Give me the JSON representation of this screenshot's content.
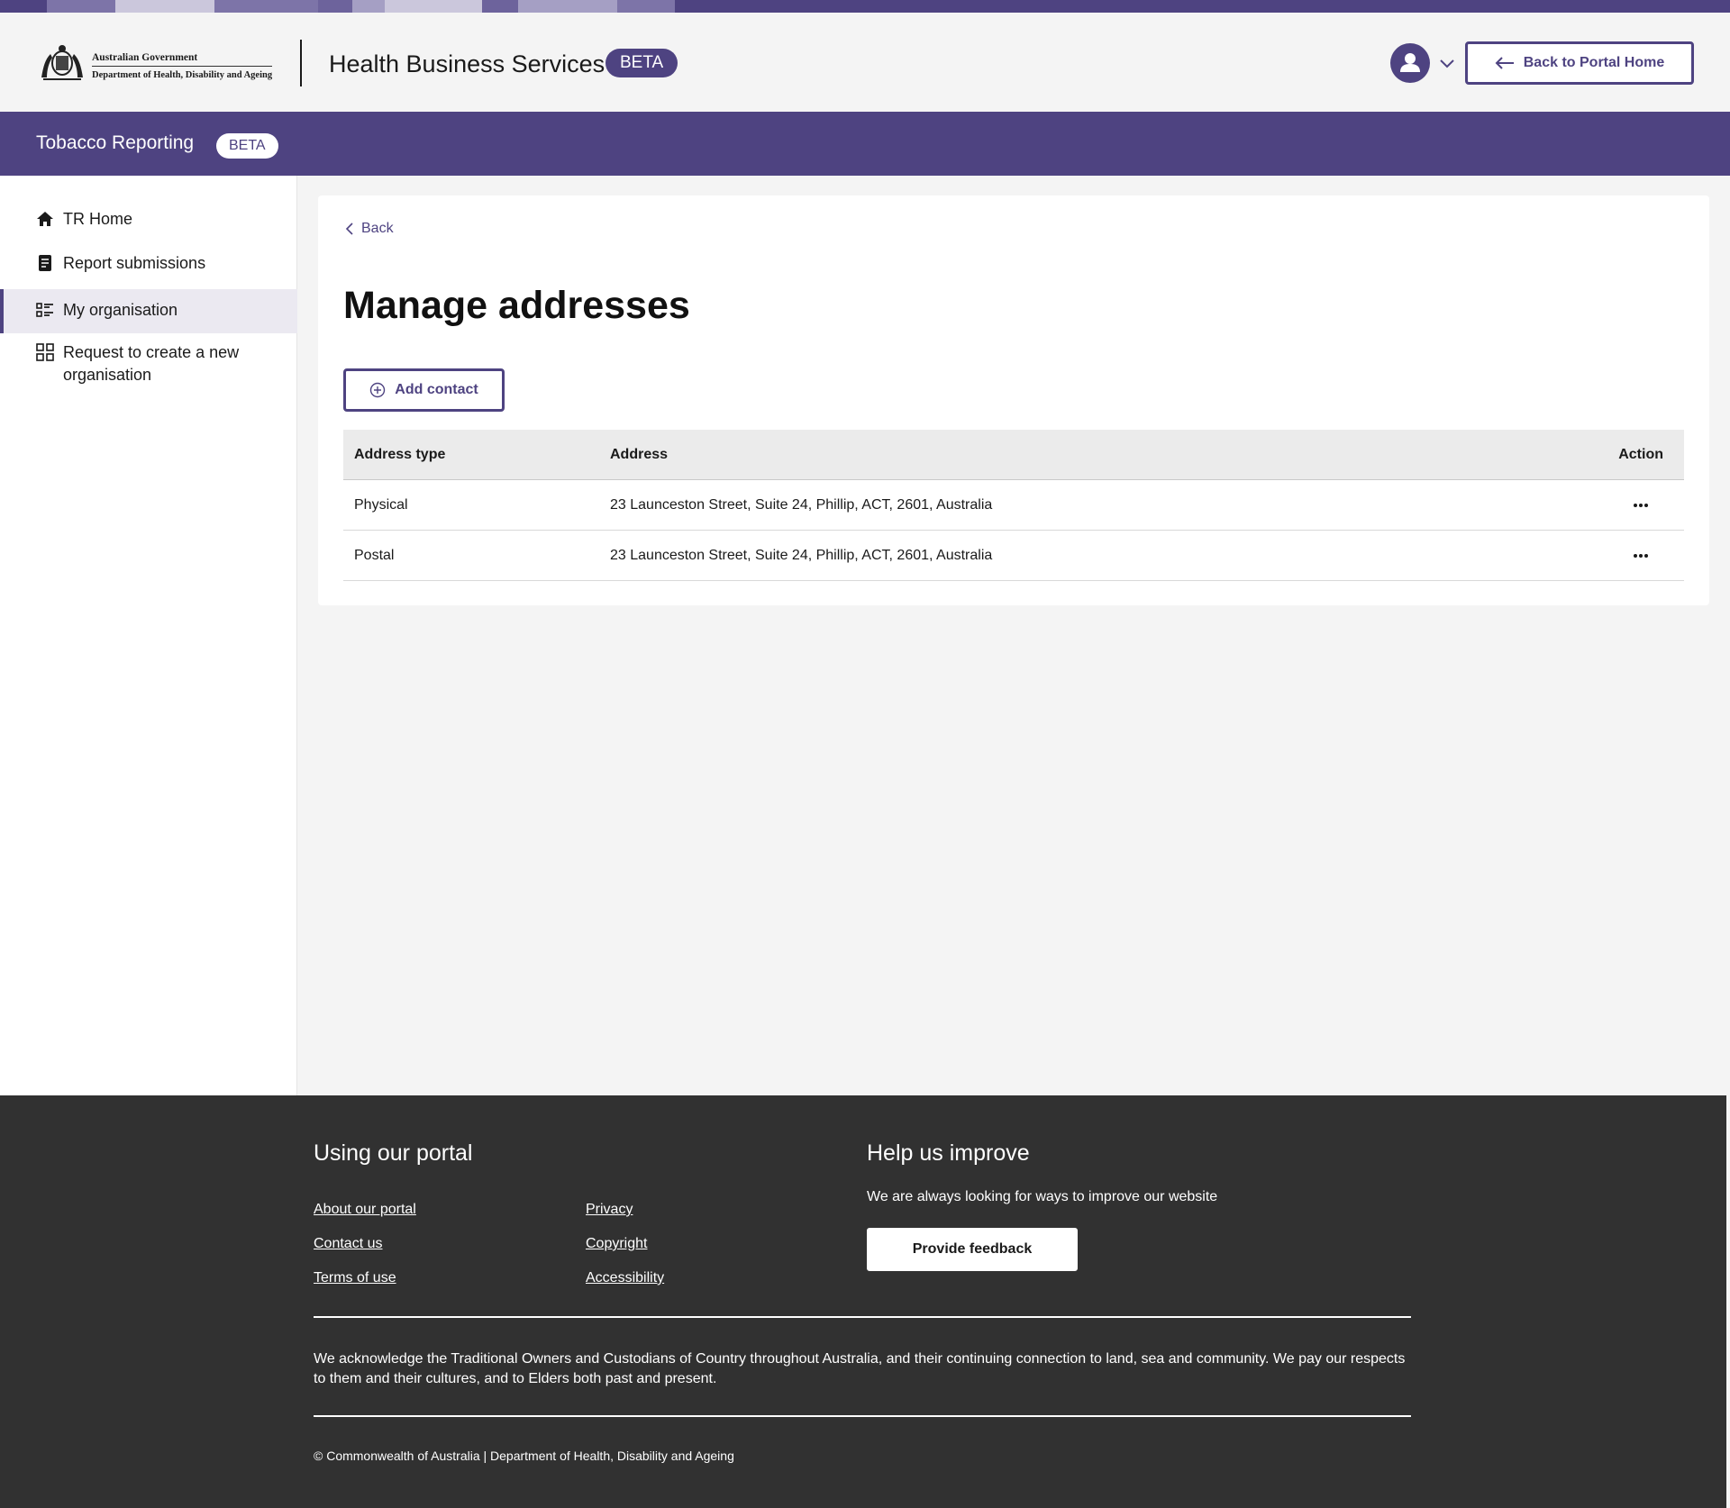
{
  "brand": {
    "gov_line1": "Australian Government",
    "gov_line2": "Department of Health, Disability and Ageing",
    "site_title": "Health Business Services",
    "beta": "BETA",
    "back_to_portal": "Back to Portal Home",
    "accent_color": "#4e4381"
  },
  "subheader": {
    "title": "Tobacco Reporting",
    "beta": "BETA"
  },
  "sidebar": {
    "items": [
      {
        "label": "TR Home",
        "icon": "home-icon"
      },
      {
        "label": "Report submissions",
        "icon": "document-icon"
      },
      {
        "label": "My organisation",
        "icon": "list-icon",
        "active": true
      },
      {
        "label": "Request to create a new organisation",
        "icon": "grid-add-icon"
      }
    ]
  },
  "main": {
    "back": "Back",
    "title": "Manage addresses",
    "add_contact": "Add contact",
    "table": {
      "headers": [
        "Address type",
        "Address",
        "Action"
      ],
      "rows": [
        {
          "type": "Physical",
          "address": "23 Launceston Street, Suite 24, Phillip, ACT, 2601, Australia"
        },
        {
          "type": "Postal",
          "address": "23 Launceston Street, Suite 24, Phillip, ACT, 2601, Australia"
        }
      ]
    }
  },
  "footer": {
    "using_heading": "Using our portal",
    "links_col1": [
      "About our portal",
      "Contact us",
      "Terms of use"
    ],
    "links_col2": [
      "Privacy",
      "Copyright",
      "Accessibility"
    ],
    "improve_heading": "Help us improve",
    "improve_text": "We are always looking for ways to improve our website",
    "feedback_button": "Provide feedback",
    "acknowledgement": "We acknowledge the Traditional Owners and Custodians of Country throughout Australia, and their continuing connection to land, sea and community. We pay our respects to them and their cultures, and to Elders both past and present.",
    "copyright": "© Commonwealth of Australia | Department of Health, Disability and Ageing"
  }
}
